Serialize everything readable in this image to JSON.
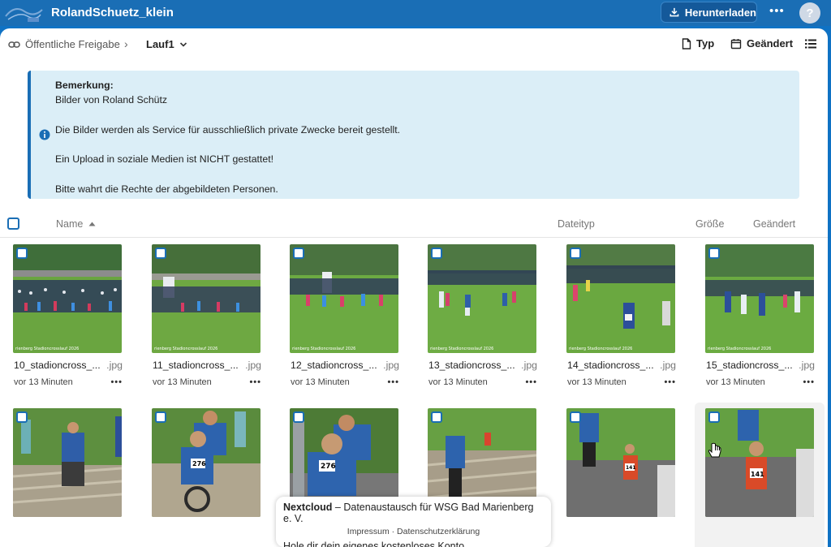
{
  "header": {
    "app_title": "RolandSchuetz_klein",
    "download_label": "Herunterladen",
    "more_label": "•••",
    "help_label": "?",
    "brand_color": "#1a6eb5"
  },
  "breadcrumb": {
    "share_label": "Öffentliche Freigabe",
    "separator": "›",
    "current": "Lauf1"
  },
  "view_controls": {
    "type_label": "Typ",
    "date_label": "Geändert"
  },
  "notice": {
    "heading": "Bemerkung:",
    "lines": [
      "Bilder von Roland Schütz",
      "",
      "Die Bilder werden als Service für ausschließlich private Zwecke bereit gestellt.",
      "",
      "Ein Upload in soziale Medien ist NICHT gestattet!",
      "",
      "Bitte wahrt die Rechte der abgebildeten Personen."
    ]
  },
  "list_header": {
    "name": "Name",
    "type": "Dateityp",
    "size": "Größe",
    "modified": "Geändert"
  },
  "files": [
    {
      "name": "10_stadioncross_...",
      "ext": ".jpg",
      "modified": "vor 13 Minuten",
      "watermark": "rienberg Stadioncrosslauf 2026"
    },
    {
      "name": "11_stadioncross_...",
      "ext": ".jpg",
      "modified": "vor 13 Minuten",
      "watermark": "rienberg Stadioncrosslauf 2026"
    },
    {
      "name": "12_stadioncross_...",
      "ext": ".jpg",
      "modified": "vor 13 Minuten",
      "watermark": "rienberg Stadioncrosslauf 2026"
    },
    {
      "name": "13_stadioncross_...",
      "ext": ".jpg",
      "modified": "vor 13 Minuten",
      "watermark": "rienberg Stadioncrosslauf 2026"
    },
    {
      "name": "14_stadioncross_...",
      "ext": ".jpg",
      "modified": "vor 13 Minuten",
      "watermark": "rienberg Stadioncrosslauf 2026"
    },
    {
      "name": "15_stadioncross_...",
      "ext": ".jpg",
      "modified": "vor 13 Minuten",
      "watermark": "rienberg Stadioncrosslauf 2026"
    },
    {
      "name": "",
      "ext": "",
      "modified": "",
      "bib": ""
    },
    {
      "name": "",
      "ext": "",
      "modified": "",
      "bib": "276"
    },
    {
      "name": "",
      "ext": "",
      "modified": "",
      "bib": "276"
    },
    {
      "name": "",
      "ext": "",
      "modified": "",
      "bib": ""
    },
    {
      "name": "",
      "ext": "",
      "modified": "",
      "bib": "141"
    },
    {
      "name": "",
      "ext": "",
      "modified": "",
      "bib": "141"
    }
  ],
  "footer": {
    "brand": "Nextcloud",
    "tagline": " – Datenaustausch für WSG Bad Marienberg e. V.",
    "links": "Impressum · Datenschutzerklärung",
    "signup": "Hole dir dein eigenes kostenloses Konto"
  }
}
